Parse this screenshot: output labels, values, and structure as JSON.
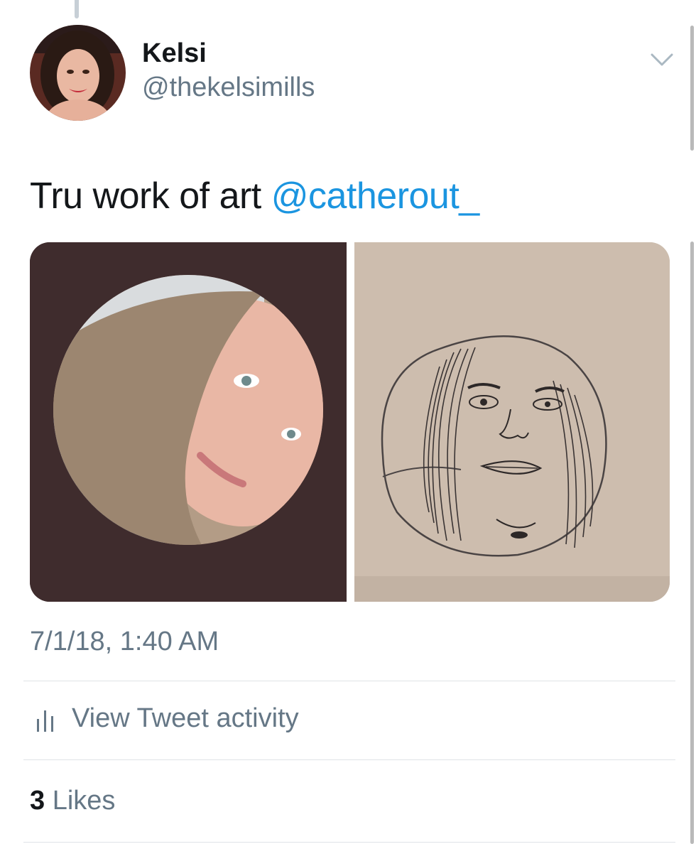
{
  "tweet": {
    "author": {
      "display_name": "Kelsi",
      "handle": "@thekelsimills"
    },
    "text": "Tru work of art ",
    "mention": "@catherout_",
    "timestamp": "7/1/18, 1:40 AM",
    "media": [
      {
        "description": "selfie photo in circular frame on dark brown background"
      },
      {
        "description": "pencil sketch of the same face on beige paper"
      }
    ]
  },
  "actions": {
    "view_activity_label": "View Tweet activity",
    "view_activity_icon": "bar-chart-icon",
    "menu_icon": "chevron-down-icon"
  },
  "stats": {
    "likes_count": "3",
    "likes_label": " Likes"
  },
  "colors": {
    "link": "#1b95e0",
    "secondary_text": "#657786",
    "primary_text": "#14171a"
  }
}
